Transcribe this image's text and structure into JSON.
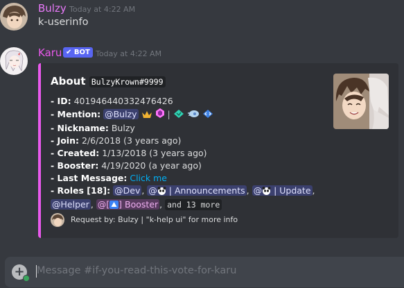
{
  "messages": [
    {
      "author": "Bulzy",
      "author_color": "#e879f9",
      "timestamp": "Today at 4:22 AM",
      "content": "k-userinfo"
    },
    {
      "author": "Karu",
      "author_color": "#ea59ed",
      "bot_tag": "BOT",
      "timestamp": "Today at 4:22 AM"
    }
  ],
  "embed": {
    "accent_color": "#ea59ed",
    "title_prefix": "About",
    "title_code": "BulzyKrown#9999",
    "fields": {
      "id_label": "- ID",
      "id_value": "401946440332476426",
      "mention_label": "- Mention",
      "mention_value": "@Bulzy",
      "nickname_label": "- Nickname",
      "nickname_value": "Bulzy",
      "join_label": "- Join",
      "join_value": "2/6/2018 (3 years ago)",
      "created_label": "- Created",
      "created_value": "1/13/2018 (3 years ago)",
      "booster_label": "- Booster",
      "booster_value": "4/19/2020 (a year ago)",
      "last_message_label": "- Last Message",
      "last_message_link": "Click me",
      "roles_label": "- Roles [18]",
      "roles": [
        "@Dev",
        "| Announcements",
        "| Update",
        "@Helper",
        "Booster"
      ],
      "roles_more": "and 13 more"
    },
    "footer": "Request by: Bulzy | \"k-help ui\" for more info"
  },
  "input": {
    "placeholder": "Message #if-you-read-this-vote-for-karu"
  },
  "colors": {
    "background": "#36393f",
    "embed_bg": "#2f3136",
    "input_bg": "#40444b",
    "mention_bg": "#4a4f87",
    "link": "#00aff4",
    "bot_tag": "#5865f2"
  },
  "icons": [
    "crown-icon",
    "booster-gem-icon",
    "hypesquad-icon",
    "discord-nitro-icon",
    "developer-icon",
    "add-attachment-icon"
  ]
}
